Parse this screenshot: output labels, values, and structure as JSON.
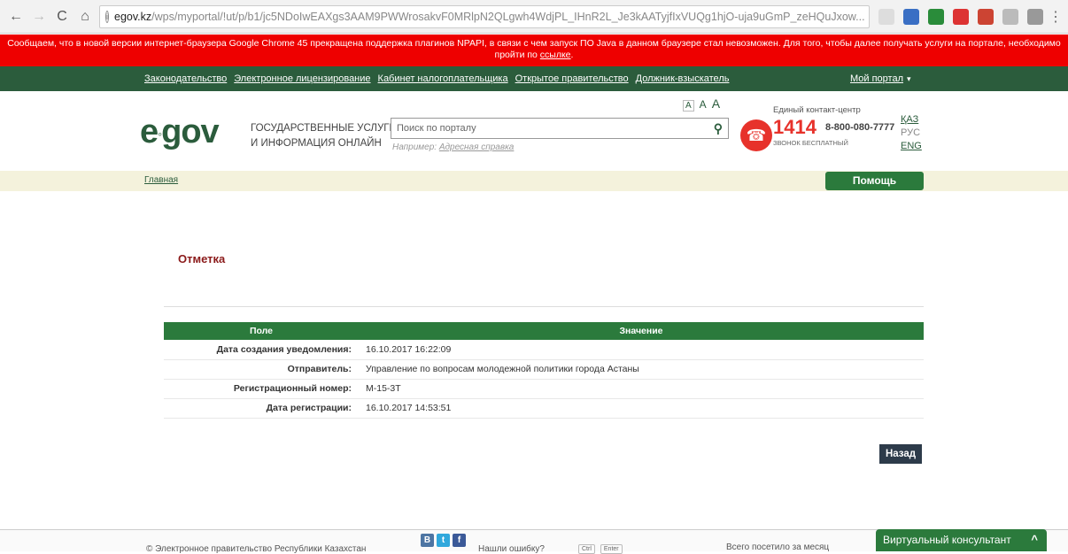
{
  "browser": {
    "url_host": "egov.kz",
    "url_path": "/wps/myportal/!ut/p/b1/jc5NDoIwEAXgs3AAM9PWWrosakvF0MRlpN2QLgwh4WdjPL_IHnR2L_Je3kAATyjfIxVUQg1hjO-uja9uGmP_zeHQuJxow...",
    "star": "☆",
    "nav": {
      "back": "←",
      "forward": "→",
      "reload": "C",
      "home": "⌂"
    },
    "info": "i",
    "menu": "⋮"
  },
  "notice": {
    "text": "Сообщаем, что в новой версии интернет-браузера Google Chrome 45 прекращена поддержка плагинов NPAPI, в связи с чем запуск ПО Java в данном браузере стал невозможен. Для того, чтобы далее получать услуги на портале, необходимо пройти по ",
    "link": "ссылке",
    "end": "."
  },
  "topnav": {
    "links": [
      "Законодательство",
      "Электронное лицензирование",
      "Кабинет налогоплательщика",
      "Открытое правительство",
      "Должник-взыскатель"
    ],
    "my_portal": "Мой портал",
    "caret": "▾"
  },
  "header": {
    "logo_e": "e",
    "logo_rest": "gov",
    "logo_dot": "◦",
    "tagline_1": "Государственные услуги",
    "tagline_2": "и информация онлайн",
    "search_placeholder": "Поиск по порталу",
    "search_icon": "⚲",
    "example_prefix": "Например: ",
    "example_link": "Адресная справка",
    "font_sizes": [
      "A",
      "A",
      "A"
    ],
    "contact_label": "Единый контакт-центр",
    "contact_number": "1414",
    "contact_phone": "8-800-080-7777",
    "contact_free": "звонок бесплатный",
    "phone_icon": "☎",
    "languages": [
      "ҚАЗ",
      "РУС",
      "ENG"
    ]
  },
  "breadcrumb": {
    "home": "Главная"
  },
  "help_button": "Помощь",
  "page_title": "Отметка",
  "table": {
    "headers": [
      "Поле",
      "Значение"
    ],
    "rows": [
      {
        "label": "Дата создания уведомления:",
        "value": "16.10.2017 16:22:09"
      },
      {
        "label": "Отправитель:",
        "value": "Управление по вопросам молодежной политики города Астаны"
      },
      {
        "label": "Регистрационный номер:",
        "value": "М-15-3Т"
      },
      {
        "label": "Дата регистрации:",
        "value": "16.10.2017 14:53:51"
      }
    ]
  },
  "back_button": "Назад",
  "footer": {
    "copyright": "© Электронное правительство Республики Казахстан",
    "social": [
      "В",
      "t",
      "f"
    ],
    "found_error": "Нашли ошибку?",
    "keys": [
      "Ctrl",
      "Enter"
    ],
    "visits": "Всего посетило за месяц",
    "consultant": "Виртуальный консультант",
    "consultant_caret": "^"
  },
  "colors": {
    "brand_green": "#2b5c3c",
    "button_green": "#2b7a3c",
    "notice_red": "#ee0000",
    "accent_red": "#e7322b"
  }
}
